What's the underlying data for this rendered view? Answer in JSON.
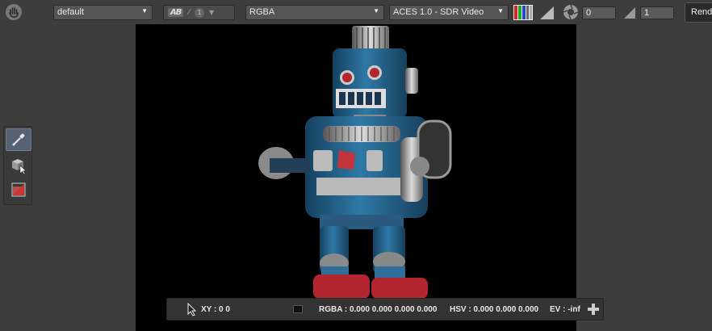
{
  "toolbar": {
    "view_preset": "default",
    "ab_label": "AB",
    "ab_number": "1",
    "channel": "RGBA",
    "display_transform": "ACES 1.0 - SDR Video",
    "exposure_value": "0",
    "gamma_value": "1",
    "render_label": "Render"
  },
  "status": {
    "xy": "XY : 0 0",
    "rgba": "RGBA : 0.000 0.000 0.000 0.000",
    "hsv": "HSV : 0.000 0.000 0.000",
    "ev": "EV : -inf"
  },
  "icons": {
    "hand": "hand-icon",
    "eyedropper": "eyedropper-icon",
    "object_pick": "cube-select-icon",
    "region": "region-crop-icon",
    "rgb_channels": "rgb-bars-icon",
    "gamma_ramp": "ramp-icon",
    "aperture": "aperture-icon",
    "zoom": "plus-icon"
  },
  "colors": {
    "toolbar_bg": "#3d3d3d",
    "viewport_bg": "#000000",
    "active_tool": "#566272",
    "robot_blue": "#2f6f99",
    "robot_red": "#b3262f"
  }
}
